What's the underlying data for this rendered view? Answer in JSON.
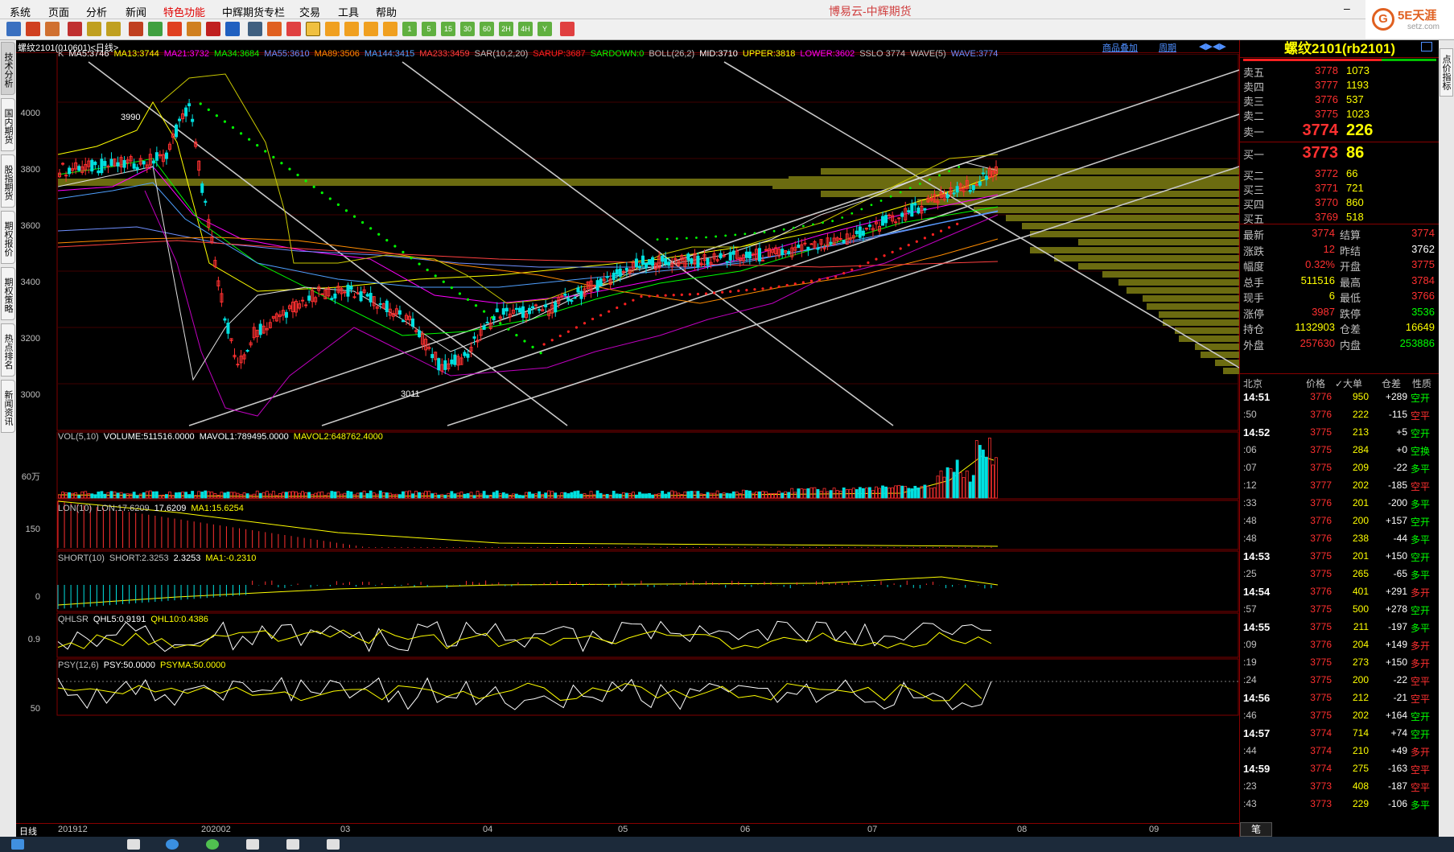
{
  "menu": {
    "items": [
      "系统",
      "页面",
      "分析",
      "新闻",
      "特色功能",
      "中辉期货专栏",
      "交易",
      "工具",
      "帮助"
    ],
    "app_title": "博易云-中辉期货"
  },
  "toolbar": {
    "buttons": [
      "1",
      "5",
      "15",
      "30",
      "60",
      "2H",
      "4H",
      "Y"
    ]
  },
  "logo": {
    "name": "5E天涯",
    "site": "setz.com"
  },
  "chart": {
    "symbol_label": "螺纹2101(010601)<日线>",
    "product_overlay": "商品叠加",
    "period": "周期",
    "main_indicators": [
      {
        "t": "K",
        "c": "#c0c0c0"
      },
      {
        "t": "MA5:3746",
        "c": "#ffffff"
      },
      {
        "t": "MA13:3744",
        "c": "#ffff00"
      },
      {
        "t": "MA21:3732",
        "c": "#ff00ff"
      },
      {
        "t": "MA34:3684",
        "c": "#00ff00"
      },
      {
        "t": "MA55:3610",
        "c": "#6f8fff"
      },
      {
        "t": "MA89:3506",
        "c": "#ff8c00"
      },
      {
        "t": "MA144:3415",
        "c": "#4fa0ff"
      },
      {
        "t": "MA233:3459",
        "c": "#ff4040"
      },
      {
        "t": "SAR(10,2,20)",
        "c": "#c0c0c0"
      },
      {
        "t": "SARUP:3687",
        "c": "#ff2020"
      },
      {
        "t": "SARDOWN:0",
        "c": "#00ff00"
      },
      {
        "t": "BOLL(26,2)",
        "c": "#c0c0c0"
      },
      {
        "t": "MID:3710",
        "c": "#ffffff"
      },
      {
        "t": "UPPER:3818",
        "c": "#ffff00"
      },
      {
        "t": "LOWER:3602",
        "c": "#ff00ff"
      },
      {
        "t": "SSLO 3774",
        "c": "#c0c0c0"
      },
      {
        "t": "WAVE(5)",
        "c": "#c0c0c0"
      },
      {
        "t": "WAVE:3774",
        "c": "#6f8fff"
      }
    ],
    "price_axis": [
      "4000",
      "3800",
      "3600",
      "3400",
      "3200",
      "3000"
    ],
    "high_label": "3990",
    "low_label": "3011",
    "volume_indicator": [
      {
        "t": "VOL(5,10)",
        "c": "#c0c0c0"
      },
      {
        "t": "VOLUME:511516.0000",
        "c": "#ffffff"
      },
      {
        "t": "MAVOL1:789495.0000",
        "c": "#ffffff"
      },
      {
        "t": "MAVOL2:648762.4000",
        "c": "#ffff00"
      }
    ],
    "volume_axis": "60万",
    "lon_indicator": [
      {
        "t": "LON(10)",
        "c": "#c0c0c0"
      },
      {
        "t": "LON:17.6209",
        "c": "#c0c0c0"
      },
      {
        "t": "17.6209",
        "c": "#ffffff"
      },
      {
        "t": "MA1:15.6254",
        "c": "#ffff00"
      }
    ],
    "lon_axis": "150",
    "short_indicator": [
      {
        "t": "SHORT(10)",
        "c": "#c0c0c0"
      },
      {
        "t": "SHORT:2.3253",
        "c": "#c0c0c0"
      },
      {
        "t": "2.3253",
        "c": "#ffffff"
      },
      {
        "t": "MA1:-0.2310",
        "c": "#ffff00"
      }
    ],
    "short_axis": "0",
    "qhlsr_indicator": [
      {
        "t": "QHLSR",
        "c": "#c0c0c0"
      },
      {
        "t": "QHL5:0.9191",
        "c": "#ffffff"
      },
      {
        "t": "QHL10:0.4386",
        "c": "#ffff00"
      }
    ],
    "qhlsr_axis": "0.9",
    "psy_indicator": [
      {
        "t": "PSY(12,6)",
        "c": "#c0c0c0"
      },
      {
        "t": "PSY:50.0000",
        "c": "#ffffff"
      },
      {
        "t": "PSYMA:50.0000",
        "c": "#ffff00"
      }
    ],
    "psy_axis": "50",
    "period_label": "日线",
    "dates": [
      "201912",
      "202002",
      "03",
      "04",
      "05",
      "06",
      "07",
      "08",
      "09"
    ]
  },
  "quote": {
    "title": "螺纹2101(rb2101)",
    "asks": [
      {
        "label": "卖五",
        "price": "3778",
        "vol": "1073"
      },
      {
        "label": "卖四",
        "price": "3777",
        "vol": "1193"
      },
      {
        "label": "卖三",
        "price": "3776",
        "vol": "537"
      },
      {
        "label": "卖二",
        "price": "3775",
        "vol": "1023"
      },
      {
        "label": "卖一",
        "price": "3774",
        "vol": "226"
      }
    ],
    "bids": [
      {
        "label": "买一",
        "price": "3773",
        "vol": "86"
      },
      {
        "label": "买二",
        "price": "3772",
        "vol": "66"
      },
      {
        "label": "买三",
        "price": "3771",
        "vol": "721"
      },
      {
        "label": "买四",
        "price": "3770",
        "vol": "860"
      },
      {
        "label": "买五",
        "price": "3769",
        "vol": "518"
      }
    ],
    "stats": [
      {
        "l1": "最新",
        "v1": "3774",
        "c1": "#ff3030",
        "l2": "结算",
        "v2": "3774",
        "c2": "#ff3030"
      },
      {
        "l1": "涨跌",
        "v1": "12",
        "c1": "#ff3030",
        "l2": "昨结",
        "v2": "3762",
        "c2": "#ffffff"
      },
      {
        "l1": "幅度",
        "v1": "0.32%",
        "c1": "#ff3030",
        "l2": "开盘",
        "v2": "3775",
        "c2": "#ff3030"
      },
      {
        "l1": "总手",
        "v1": "511516",
        "c1": "#ffff00",
        "l2": "最高",
        "v2": "3784",
        "c2": "#ff3030"
      },
      {
        "l1": "现手",
        "v1": "6",
        "c1": "#ffff00",
        "l2": "最低",
        "v2": "3766",
        "c2": "#ff3030"
      },
      {
        "l1": "涨停",
        "v1": "3987",
        "c1": "#ff3030",
        "l2": "跌停",
        "v2": "3536",
        "c2": "#00ff00"
      },
      {
        "l1": "持仓",
        "v1": "1132903",
        "c1": "#ffff00",
        "l2": "仓差",
        "v2": "16649",
        "c2": "#ffff00"
      },
      {
        "l1": "外盘",
        "v1": "257630",
        "c1": "#ff3030",
        "l2": "内盘",
        "v2": "253886",
        "c2": "#00ff00"
      }
    ],
    "tick_headers": [
      "北京",
      "价格",
      "✓大单",
      "仓差",
      "性质"
    ],
    "ticks": [
      {
        "t": "14:51",
        "b": true,
        "p": "3776",
        "v": "950",
        "d": "+289",
        "n": "空开",
        "nc": "#00ff00"
      },
      {
        "t": ":50",
        "b": false,
        "p": "3776",
        "v": "222",
        "d": "-115",
        "n": "空平",
        "nc": "#ff3030"
      },
      {
        "t": "14:52",
        "b": true,
        "p": "3775",
        "v": "213",
        "d": "+5",
        "n": "空开",
        "nc": "#00ff00"
      },
      {
        "t": ":06",
        "b": false,
        "p": "3775",
        "v": "284",
        "d": "+0",
        "n": "空换",
        "nc": "#00ff00"
      },
      {
        "t": ":07",
        "b": false,
        "p": "3775",
        "v": "209",
        "d": "-22",
        "n": "多平",
        "nc": "#00ff00"
      },
      {
        "t": ":12",
        "b": false,
        "p": "3777",
        "v": "202",
        "d": "-185",
        "n": "空平",
        "nc": "#ff3030"
      },
      {
        "t": ":33",
        "b": false,
        "p": "3776",
        "v": "201",
        "d": "-200",
        "n": "多平",
        "nc": "#00ff00"
      },
      {
        "t": ":48",
        "b": false,
        "p": "3776",
        "v": "200",
        "d": "+157",
        "n": "空开",
        "nc": "#00ff00"
      },
      {
        "t": ":48",
        "b": false,
        "p": "3776",
        "v": "238",
        "d": "-44",
        "n": "多平",
        "nc": "#00ff00"
      },
      {
        "t": "14:53",
        "b": true,
        "p": "3775",
        "v": "201",
        "d": "+150",
        "n": "空开",
        "nc": "#00ff00"
      },
      {
        "t": ":25",
        "b": false,
        "p": "3775",
        "v": "265",
        "d": "-65",
        "n": "多平",
        "nc": "#00ff00"
      },
      {
        "t": "14:54",
        "b": true,
        "p": "3776",
        "v": "401",
        "d": "+291",
        "n": "多开",
        "nc": "#ff3030"
      },
      {
        "t": ":57",
        "b": false,
        "p": "3775",
        "v": "500",
        "d": "+278",
        "n": "空开",
        "nc": "#00ff00"
      },
      {
        "t": "14:55",
        "b": true,
        "p": "3775",
        "v": "211",
        "d": "-197",
        "n": "多平",
        "nc": "#00ff00"
      },
      {
        "t": ":09",
        "b": false,
        "p": "3776",
        "v": "204",
        "d": "+149",
        "n": "多开",
        "nc": "#ff3030"
      },
      {
        "t": ":19",
        "b": false,
        "p": "3775",
        "v": "273",
        "d": "+150",
        "n": "多开",
        "nc": "#ff3030"
      },
      {
        "t": ":24",
        "b": false,
        "p": "3775",
        "v": "200",
        "d": "-22",
        "n": "空平",
        "nc": "#ff3030"
      },
      {
        "t": "14:56",
        "b": true,
        "p": "3775",
        "v": "212",
        "d": "-21",
        "n": "空平",
        "nc": "#ff3030"
      },
      {
        "t": ":46",
        "b": false,
        "p": "3775",
        "v": "202",
        "d": "+164",
        "n": "空开",
        "nc": "#00ff00"
      },
      {
        "t": "14:57",
        "b": true,
        "p": "3774",
        "v": "714",
        "d": "+74",
        "n": "空开",
        "nc": "#00ff00"
      },
      {
        "t": ":44",
        "b": false,
        "p": "3774",
        "v": "210",
        "d": "+49",
        "n": "多开",
        "nc": "#ff3030"
      },
      {
        "t": "14:59",
        "b": true,
        "p": "3774",
        "v": "275",
        "d": "-163",
        "n": "空平",
        "nc": "#ff3030"
      },
      {
        "t": ":23",
        "b": false,
        "p": "3773",
        "v": "408",
        "d": "-187",
        "n": "空平",
        "nc": "#ff3030"
      },
      {
        "t": ":43",
        "b": false,
        "p": "3773",
        "v": "229",
        "d": "-106",
        "n": "多平",
        "nc": "#00ff00"
      }
    ],
    "bottom_tab": "笔"
  },
  "left_tabs": [
    "技术分析",
    "国内期货",
    "股指期货",
    "期权报价",
    "期权策略",
    "热点排名",
    "新闻资讯"
  ],
  "right_tab": "点价指标"
}
